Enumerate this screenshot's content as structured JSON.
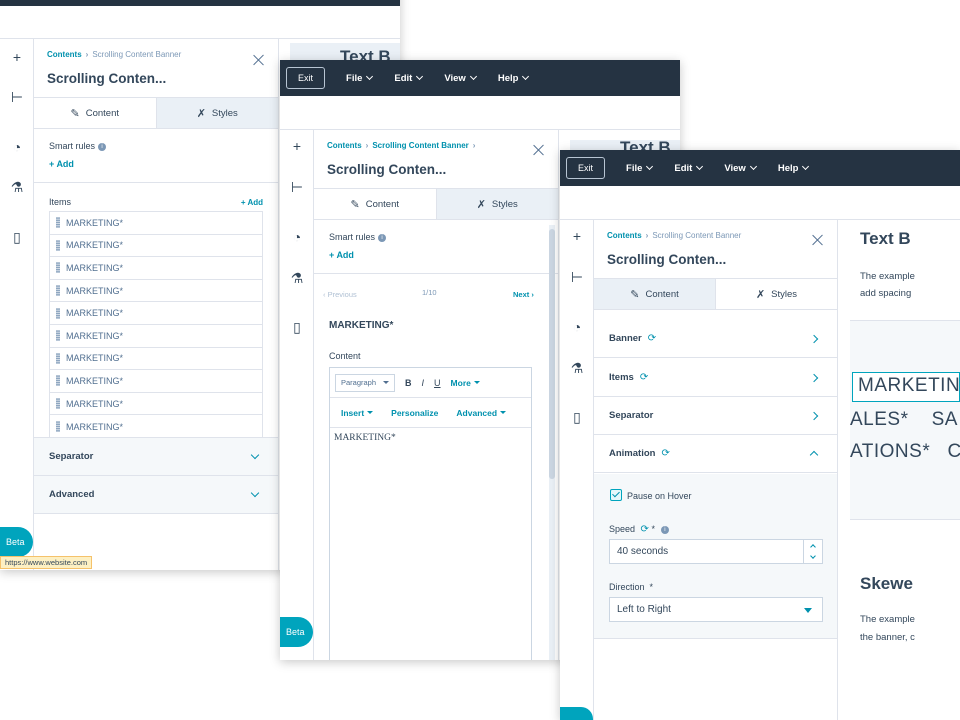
{
  "topbar": {
    "exit_label": "Exit",
    "menus": [
      "File",
      "Edit",
      "View",
      "Help"
    ]
  },
  "rail": {
    "icons": [
      "plus-icon",
      "tree-icon",
      "gauge-icon",
      "flask-icon",
      "page-icon"
    ]
  },
  "panel": {
    "breadcrumb_root": "Contents",
    "breadcrumb_current": "Scrolling Content Banner",
    "title": "Scrolling Conten...",
    "tab_content": "Content",
    "tab_styles": "Styles"
  },
  "window1": {
    "smart_rules_label": "Smart rules",
    "add_label": "Add",
    "items_label": "Items",
    "items_add_label": "+ Add",
    "items": [
      "MARKETING*",
      "MARKETING*",
      "MARKETING*",
      "MARKETING*",
      "MARKETING*",
      "MARKETING*",
      "MARKETING*",
      "MARKETING*",
      "MARKETING*",
      "MARKETING*"
    ],
    "separator_label": "Separator",
    "advanced_label": "Advanced",
    "beta_label": "Beta",
    "url_tooltip": "https://www.website.com",
    "preview_heading": "Text B"
  },
  "window2": {
    "smart_rules_label": "Smart rules",
    "add_label": "Add",
    "prev_label": "Previous",
    "next_label": "Next",
    "page_indicator": "1/10",
    "item_title": "MARKETING*",
    "content_label": "Content",
    "paragraph_select": "Paragraph",
    "bold": "B",
    "italic": "I",
    "underline": "U",
    "more_label": "More",
    "insert_label": "Insert",
    "personalize_label": "Personalize",
    "advanced_label": "Advanced",
    "editor_text": "MARKETING*",
    "beta_label": "Beta",
    "preview_heading": "Text B"
  },
  "window3": {
    "banner_label": "Banner",
    "items_label": "Items",
    "separator_label": "Separator",
    "animation_label": "Animation",
    "pause_on_hover_label": "Pause on Hover",
    "speed_label": "Speed",
    "speed_value": "40 seconds",
    "direction_label": "Direction",
    "direction_value": "Left to Right",
    "required_mark": "*",
    "preview": {
      "heading1": "Text B",
      "text1_line1": "The example",
      "text1_line2": "add spacing",
      "marquee1": "MARKETIN",
      "marquee2": "ALES*    SA",
      "marquee3": "ATIONS*   C",
      "heading2": "Skewe",
      "text2_line1": "The example",
      "text2_line2": "the banner, c"
    }
  },
  "colors": {
    "topbar": "#253342",
    "accent": "#0091ae",
    "beta": "#00a4bd",
    "text": "#33475b"
  }
}
